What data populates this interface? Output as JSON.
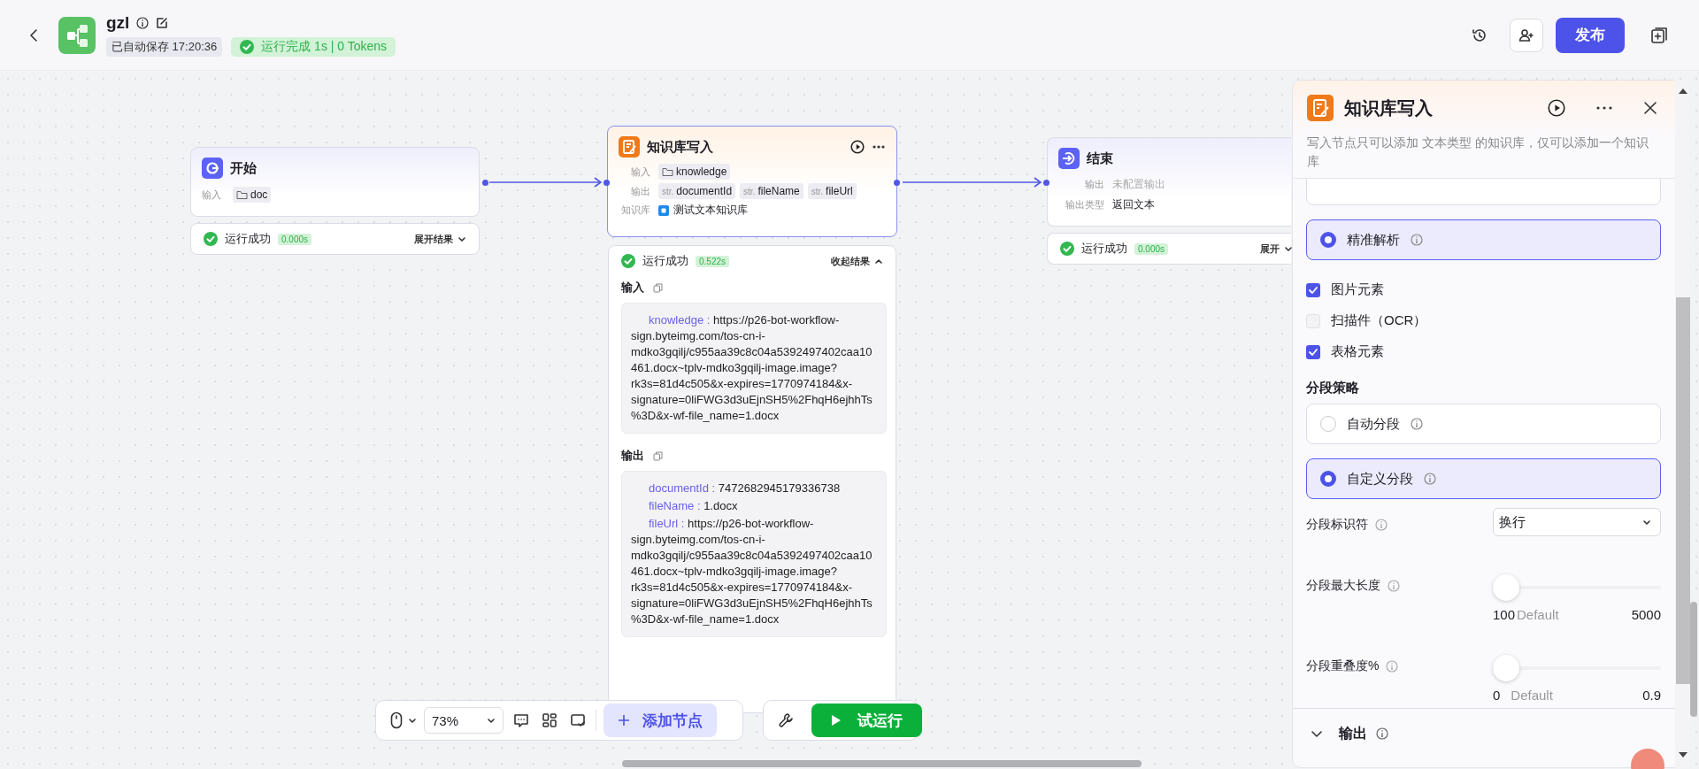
{
  "header": {
    "title": "gzl",
    "autosave": "已自动保存 17:20:36",
    "run_status": "运行完成 1s | 0 Tokens",
    "publish": "发布"
  },
  "nodes": [
    {
      "kind": "start",
      "title": "开始",
      "rows": [
        {
          "label": "输入",
          "tags": [
            {
              "kind": "file",
              "name": "doc"
            }
          ]
        }
      ],
      "result": {
        "status": "运行成功",
        "time": "0.000s",
        "toggle": "展开结果",
        "expanded": false
      }
    },
    {
      "kind": "knowledge",
      "title": "知识库写入",
      "rows": [
        {
          "label": "输入",
          "tags": [
            {
              "kind": "file",
              "name": "knowledge"
            }
          ]
        },
        {
          "label": "输出",
          "tags": [
            {
              "kind": "string",
              "prefix": "str.",
              "name": "documentId"
            },
            {
              "kind": "string",
              "prefix": "str.",
              "name": "fileName"
            },
            {
              "kind": "string",
              "prefix": "str.",
              "name": "fileUrl"
            }
          ]
        },
        {
          "label": "知识库",
          "tags": [
            {
              "kind": "dataset",
              "name": "测试文本知识库"
            }
          ]
        }
      ],
      "result": {
        "status": "运行成功",
        "time": "0.522s",
        "toggle": "收起结果",
        "expanded": true,
        "sections": [
          {
            "title": "输入",
            "entries": [
              {
                "key": "knowledge :",
                "value": "https://p26-bot-workflow-sign.byteimg.com/tos-cn-i-mdko3gqilj/c955aa39c8c04a5392497402caa10461.docx~tplv-mdko3gqilj-image.image?rk3s=81d4c505&x-expires=1770974184&x-signature=0liFWG3d3uEjnSH5%2FhqH6ejhhTs%3D&x-wf-file_name=1.docx"
              }
            ]
          },
          {
            "title": "输出",
            "entries": [
              {
                "key": "documentId :",
                "value": "7472682945179336738"
              },
              {
                "key": "fileName :",
                "value": "1.docx"
              },
              {
                "key": "fileUrl :",
                "value": "https://p26-bot-workflow-sign.byteimg.com/tos-cn-i-mdko3gqilj/c955aa39c8c04a5392497402caa10461.docx~tplv-mdko3gqilj-image.image?rk3s=81d4c505&x-expires=1770974184&x-signature=0liFWG3d3uEjnSH5%2FhqH6ejhhTs%3D&x-wf-file_name=1.docx"
              }
            ]
          }
        ]
      }
    },
    {
      "kind": "end",
      "title": "结束",
      "rows": [
        {
          "label": "输出",
          "tags": [
            {
              "kind": "empty",
              "name": "未配置输出"
            }
          ]
        },
        {
          "label": "输出类型",
          "tags": [
            {
              "kind": "plain",
              "name": "返回文本"
            }
          ]
        }
      ],
      "result": {
        "status": "运行成功",
        "time": "0.000s",
        "toggle": "展开",
        "expanded": false
      }
    }
  ],
  "panel": {
    "title": "知识库写入",
    "description": "写入节点只可以添加 文本类型 的知识库，仅可以添加一个知识库",
    "items": [
      {
        "kind": "radio",
        "label": "精准解析",
        "selected": true
      },
      {
        "kind": "checkbox",
        "label": "图片元素",
        "checked": true
      },
      {
        "kind": "checkbox",
        "label": "扫描件（OCR）",
        "checked": false
      },
      {
        "kind": "checkbox",
        "label": "表格元素",
        "checked": true
      },
      {
        "kind": "heading",
        "label": "分段策略"
      },
      {
        "kind": "radio",
        "label": "自动分段",
        "selected": false
      },
      {
        "kind": "radio",
        "label": "自定义分段",
        "selected": true
      },
      {
        "kind": "select",
        "label": "分段标识符",
        "value": "换行"
      },
      {
        "kind": "slider",
        "label": "分段最大长度",
        "level": 0,
        "min": "100",
        "default": "Default",
        "max": "5000"
      },
      {
        "kind": "slider",
        "label": "分段重叠度%",
        "level": 0,
        "min": "0",
        "default": "Default",
        "max": "0.9"
      }
    ],
    "footer": {
      "label": "输出",
      "expanded": false
    }
  },
  "toolbar": {
    "zoom": "73%",
    "add_node": "添加节点",
    "run": "试运行"
  }
}
